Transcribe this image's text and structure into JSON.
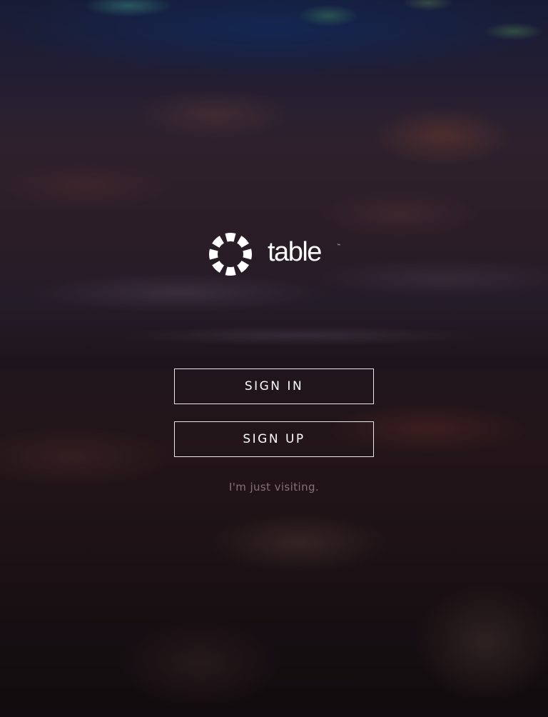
{
  "brand": {
    "wordmark": "table",
    "trademark": "™",
    "logo_icon": "dashed-circle-logo-icon",
    "color": "#ffffff"
  },
  "actions": {
    "sign_in_label": "SIGN IN",
    "sign_up_label": "SIGN UP",
    "visit_label": "I'm just visiting."
  },
  "background": {
    "description_icon": "blurred-crowd-background-image"
  }
}
